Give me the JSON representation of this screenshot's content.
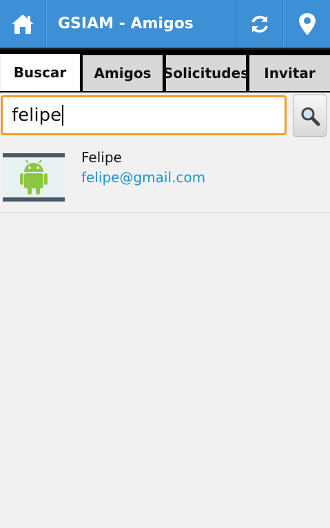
{
  "header": {
    "title": "GSIAM - Amigos",
    "icons": [
      "home-icon",
      "refresh-icon",
      "location-pin-icon"
    ],
    "color": "#3d8fd6"
  },
  "tabs": [
    {
      "label": "Buscar",
      "active": true
    },
    {
      "label": "Amigos",
      "active": false
    },
    {
      "label": "Solicitudes",
      "active": false
    },
    {
      "label": "Invitar",
      "active": false
    }
  ],
  "search": {
    "value": "felipe",
    "button_icon": "search-icon",
    "focus_color": "#f49b2a"
  },
  "results": [
    {
      "name": "Felipe",
      "email": "felipe@gmail.com",
      "avatar_icon": "android-icon"
    }
  ]
}
